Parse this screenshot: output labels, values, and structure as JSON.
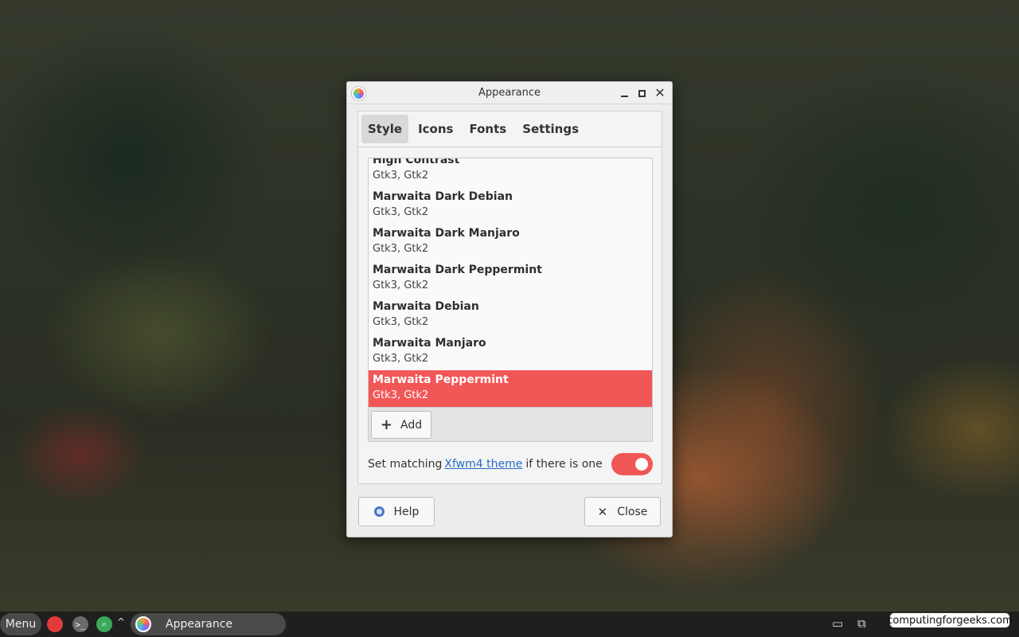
{
  "window": {
    "title": "Appearance",
    "tabs": [
      {
        "label": "Style",
        "active": true
      },
      {
        "label": "Icons",
        "active": false
      },
      {
        "label": "Fonts",
        "active": false
      },
      {
        "label": "Settings",
        "active": false
      }
    ],
    "themes": [
      {
        "name": "High Contrast",
        "formats": "Gtk3, Gtk2",
        "selected": false
      },
      {
        "name": "Marwaita Dark Debian",
        "formats": "Gtk3, Gtk2",
        "selected": false
      },
      {
        "name": "Marwaita Dark Manjaro",
        "formats": "Gtk3, Gtk2",
        "selected": false
      },
      {
        "name": "Marwaita Dark Peppermint",
        "formats": "Gtk3, Gtk2",
        "selected": false
      },
      {
        "name": "Marwaita Debian",
        "formats": "Gtk3, Gtk2",
        "selected": false
      },
      {
        "name": "Marwaita Manjaro",
        "formats": "Gtk3, Gtk2",
        "selected": false
      },
      {
        "name": "Marwaita Peppermint",
        "formats": "Gtk3, Gtk2",
        "selected": true
      }
    ],
    "add_label": "Add",
    "match": {
      "prefix": "Set matching",
      "link": "Xfwm4 theme",
      "suffix": "if there is one",
      "enabled": true
    },
    "help_label": "Help",
    "close_label": "Close",
    "accent_color": "#f25757"
  },
  "taskbar": {
    "menu_label": "Menu",
    "task_label": "Appearance",
    "watermark": "computingforgeeks.com"
  }
}
